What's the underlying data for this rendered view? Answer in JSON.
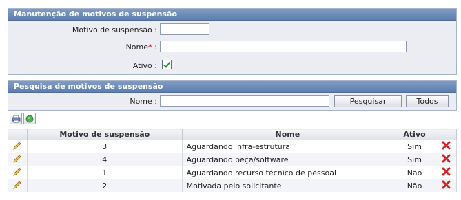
{
  "form_panel": {
    "title": "Manutenção de motivos de suspensão",
    "motivo_label": "Motivo de suspensão :",
    "motivo_value": "",
    "nome_label": "Nome",
    "nome_required": "*",
    "nome_colon": " :",
    "nome_value": "",
    "ativo_label": "Ativo :",
    "ativo_checked": true
  },
  "search_panel": {
    "title": "Pesquisa de motivos de suspensão",
    "nome_label": "Nome :",
    "nome_value": "",
    "search_button": "Pesquisar",
    "all_button": "Todos"
  },
  "toolbar": {
    "icons": [
      "print-icon",
      "globe-icon"
    ]
  },
  "table": {
    "headers": [
      "",
      "Motivo de suspensão",
      "Nome",
      "Ativo",
      ""
    ],
    "rows": [
      {
        "motivo": "3",
        "nome": "Aguardando infra-estrutura",
        "ativo": "Sim"
      },
      {
        "motivo": "4",
        "nome": "Aguardando peça/software",
        "ativo": "Sim"
      },
      {
        "motivo": "1",
        "nome": "Aguardando recurso técnico de pessoal",
        "ativo": "Não"
      },
      {
        "motivo": "2",
        "nome": "Motivada pelo solicitante",
        "ativo": "Não"
      }
    ],
    "row_icons": [
      "edit-pencil-icon",
      "delete-x-icon"
    ]
  },
  "colors": {
    "header_gradient_top": "#7f9cc6",
    "header_gradient_bottom": "#5d7eae",
    "panel_bg": "#ecedf3",
    "delete_red": "#d62020",
    "check_green": "#2a8a2a"
  }
}
